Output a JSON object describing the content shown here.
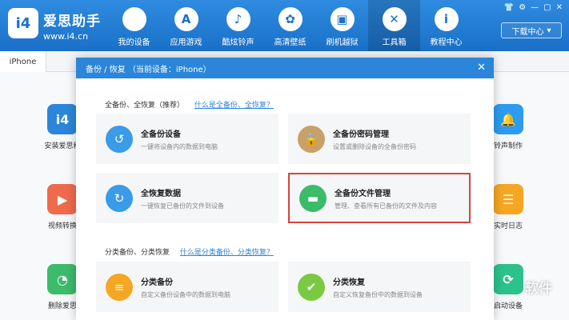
{
  "brand": {
    "logo_text": "i4",
    "name": "爱思助手",
    "url": "www.i4.cn"
  },
  "nav": [
    {
      "label": "我的设备",
      "icon": ""
    },
    {
      "label": "应用游戏",
      "icon": "A"
    },
    {
      "label": "酷炫铃声",
      "icon": "♪"
    },
    {
      "label": "高清壁纸",
      "icon": "✿"
    },
    {
      "label": "刷机越狱",
      "icon": "▣"
    },
    {
      "label": "工具箱",
      "icon": "✕"
    },
    {
      "label": "教程中心",
      "icon": "i"
    }
  ],
  "window_controls": {
    "shirt": "👕",
    "settings": "⚙",
    "minimize": "—",
    "maximize": "▢",
    "close": "✕"
  },
  "download_center": {
    "label": "下载中心",
    "icon": "▾"
  },
  "device_tab": "iPhone",
  "background_tiles": [
    {
      "label": "安装爱思移",
      "icon": "i4",
      "color": "#2b86da"
    },
    {
      "label": "视频转换",
      "icon": "▶",
      "color": "#ef6a4d"
    },
    {
      "label": "删除爱思",
      "icon": "◔",
      "color": "#3cbb6a"
    },
    {
      "label": "铃声制作",
      "icon": "🔔",
      "color": "#2b9cf0"
    },
    {
      "label": "实时日志",
      "icon": "☰",
      "color": "#f5a623"
    },
    {
      "label": "启动设备",
      "icon": "⟳",
      "color": "#2bc28c"
    }
  ],
  "modal": {
    "title": "备份 / 恢复   （当前设备：iPhone）",
    "close": "✕",
    "section1": {
      "title": "全备份、全恢复（推荐）",
      "link": "什么是全备份、全恢复？"
    },
    "section2": {
      "title": "分类备份、分类恢复",
      "link": "什么是分类备份、分类恢复？"
    },
    "cards": {
      "full_backup": {
        "title": "全备份设备",
        "desc": "一键将设备内的数据到电脑",
        "icon": "↺",
        "color": "#3a9be8"
      },
      "backup_password": {
        "title": "全备份密码管理",
        "desc": "设置或删除设备的全备份密码",
        "icon": "🔒",
        "color": "#c9a06a"
      },
      "full_restore": {
        "title": "全恢复数据",
        "desc": "一键恢复已备份的文件到设备",
        "icon": "↻",
        "color": "#3a9be8"
      },
      "backup_files": {
        "title": "全备份文件管理",
        "desc": "管理、查看所有已备份的文件及内容",
        "icon": "▬",
        "color": "#3cbb6a"
      },
      "category_backup": {
        "title": "分类备份",
        "desc": "自定义备份设备中的数据到电脑",
        "icon": "≡",
        "color": "#f5a623"
      },
      "category_restore": {
        "title": "分类恢复",
        "desc": "自定义恢复备份中的数据到设备",
        "icon": "✔",
        "color": "#7ac943"
      }
    }
  },
  "watermark": "软件"
}
